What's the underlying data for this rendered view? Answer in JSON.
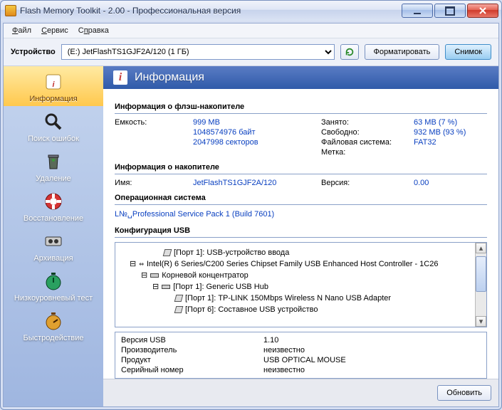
{
  "window": {
    "title": "Flash Memory Toolkit - 2.00 - Профессиональная версия"
  },
  "menu": {
    "file": "Файл",
    "service": "Сервис",
    "help": "Справка"
  },
  "devicebar": {
    "label": "Устройство",
    "selected": "(E:) JetFlashTS1GJF2A/120 (1 ГБ)",
    "format": "Форматировать",
    "snapshot": "Снимок"
  },
  "sidebar": {
    "items": [
      {
        "label": "Информация"
      },
      {
        "label": "Поиск ошибок"
      },
      {
        "label": "Удаление"
      },
      {
        "label": "Восстановление"
      },
      {
        "label": "Архивация"
      },
      {
        "label": "Низкоуровневый тест"
      },
      {
        "label": "Быстродействие"
      }
    ]
  },
  "header": {
    "title": "Информация"
  },
  "sections": {
    "flashinfo": "Информация о флэш-накопителе",
    "driveinfo": "Информация о накопителе",
    "os": "Операционная система",
    "usbconf": "Конфигурация USB"
  },
  "flash": {
    "capacity_k": "Емкость:",
    "capacity_v": "999 MB",
    "bytes": "1048574976 байт",
    "sectors": "2047998 секторов",
    "used_k": "Занято:",
    "used_v": "63 MB (7 %)",
    "free_k": "Свободно:",
    "free_v": "932 MB (93 %)",
    "fs_k": "Файловая система:",
    "fs_v": "FAT32",
    "label_k": "Метка:"
  },
  "drive": {
    "name_k": "Имя:",
    "name_v": "JetFlashTS1GJF2A/120",
    "ver_k": "Версия:",
    "ver_v": "0.00"
  },
  "os_text": "L№␣Professional Service Pack 1 (Build 7601)",
  "tree": {
    "n0": "[Порт 1]: USB-устройство ввода",
    "n1": "Intel(R) 6 Series/C200 Series Chipset Family USB Enhanced Host Controller - 1C26",
    "n2": "Корневой концентратор",
    "n3": "[Порт 1]: Generic USB Hub",
    "n4": "[Порт 1]: TP-LINK 150Mbps Wireless N Nano USB Adapter",
    "n5": "[Порт 6]: Составное USB устройство"
  },
  "usbinfo": {
    "ver_k": "Версия USB",
    "ver_v": "1.10",
    "vendor_k": "Производитель",
    "vendor_v": "неизвестно",
    "product_k": "Продукт",
    "product_v": "   USB OPTICAL MOUSE",
    "serial_k": "Серийный номер",
    "serial_v": "неизвестно"
  },
  "buttons": {
    "refresh": "Обновить"
  }
}
